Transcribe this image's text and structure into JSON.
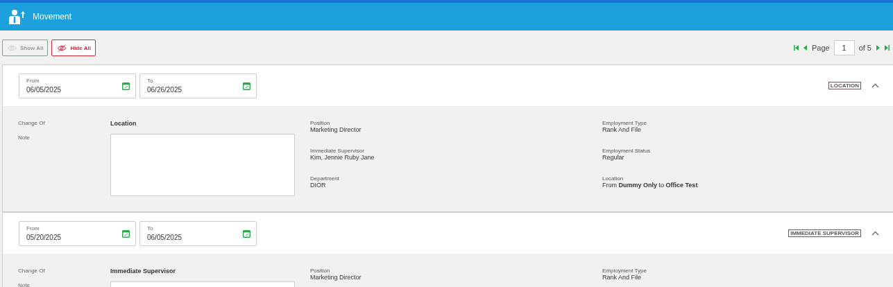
{
  "header": {
    "title": "Movement"
  },
  "toolbar": {
    "buttons": [
      {
        "label": "Show All",
        "disabled": true
      },
      {
        "label": "Hide All",
        "disabled": false
      }
    ]
  },
  "pagination": {
    "page_label": "Page",
    "page": "1",
    "of_label": "of",
    "total": "5"
  },
  "movements": [
    {
      "from_label": "From",
      "from": "06/05/2025",
      "to_label": "To",
      "to": "06/26/2025",
      "tag": "LOCATION",
      "expanded": true,
      "change_of_label": "Change Of",
      "change_of": "Location",
      "note_label": "Note",
      "fields": [
        {
          "label": "Position",
          "value": "Marketing Director"
        },
        {
          "label": "Employment Type",
          "value": "Rank And File"
        },
        {
          "label": "Immediate Supervisor",
          "value": "Kim, Jennie Ruby Jane"
        },
        {
          "label": "Employment Status",
          "value": "Regular"
        },
        {
          "label": "Department",
          "value": "DIOR"
        },
        {
          "label": "Location",
          "value": "From **Dummy Only** to **Office Test**"
        }
      ]
    },
    {
      "from_label": "From",
      "from": "05/20/2025",
      "to_label": "To",
      "to": "06/05/2025",
      "tag": "IMMEDIATE SUPERVISOR",
      "expanded": true,
      "change_of_label": "Change Of",
      "change_of": "Immediate Supervisor",
      "note_label": "Note",
      "fields": [
        {
          "label": "Position",
          "value": "Marketing Director"
        },
        {
          "label": "Employment Type",
          "value": "Rank And File"
        }
      ]
    }
  ]
}
